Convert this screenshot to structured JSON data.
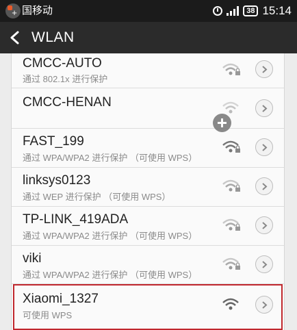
{
  "status_bar": {
    "carrier": "国移动",
    "badge_glyph": "+",
    "battery": "38",
    "time": "15:14"
  },
  "header": {
    "title": "WLAN",
    "back_icon": "chevron-left-icon"
  },
  "networks": [
    {
      "ssid": "CMCC-AUTO",
      "detail": "通过 802.1x 进行保护",
      "signal": "medium",
      "locked": true
    },
    {
      "ssid": "CMCC-HENAN",
      "detail": "",
      "signal": "low",
      "locked": false
    },
    {
      "ssid": "FAST_199",
      "detail": "通过 WPA/WPA2 进行保护 （可使用 WPS）",
      "signal": "high",
      "locked": true
    },
    {
      "ssid": "linksys0123",
      "detail": "通过 WEP 进行保护 （可使用 WPS）",
      "signal": "medium",
      "locked": true
    },
    {
      "ssid": "TP-LINK_419ADA",
      "detail": "通过 WPA/WPA2 进行保护 （可使用 WPS）",
      "signal": "medium",
      "locked": true
    },
    {
      "ssid": "viki",
      "detail": "通过 WPA/WPA2 进行保护 （可使用 WPS）",
      "signal": "medium",
      "locked": true
    },
    {
      "ssid": "Xiaomi_1327",
      "detail": "可使用 WPS",
      "signal": "high",
      "locked": false
    }
  ],
  "colors": {
    "highlight_border": "#c0272d",
    "title_bar": "#2b2b2b",
    "status_bar": "#1b1b1b"
  }
}
